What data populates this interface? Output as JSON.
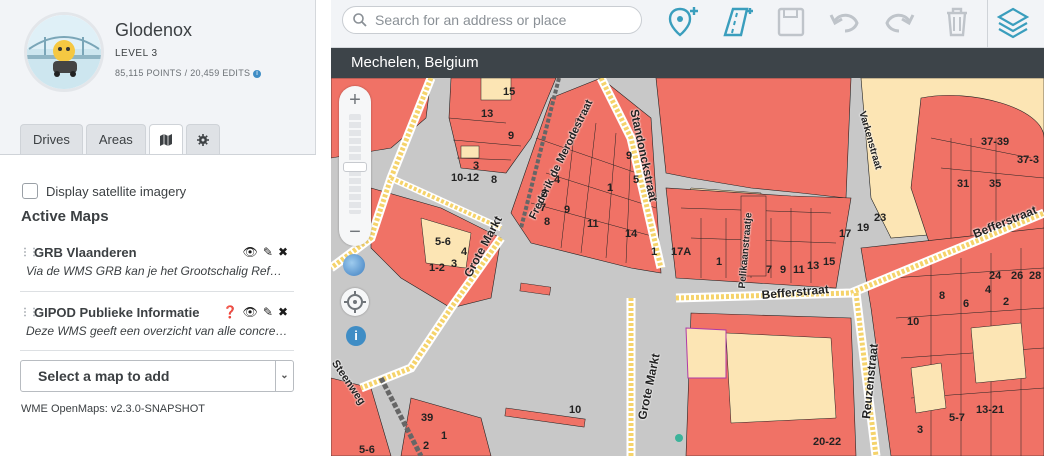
{
  "profile": {
    "username": "Glodenox",
    "level": "LEVEL 3",
    "points": "85,115 POINTS",
    "separator": "/",
    "edits": "20,459 EDITS"
  },
  "tabs": [
    {
      "label": "Drives"
    },
    {
      "label": "Areas"
    },
    {
      "label": "map-icon"
    },
    {
      "label": "gear-icon"
    }
  ],
  "panel": {
    "satellite_label": "Display satellite imagery",
    "active_maps_title": "Active Maps",
    "maps": [
      {
        "title": "GRB Vlaanderen",
        "desc": "Via de WMS GRB kan je het Grootschalig Referentie Bestand raadplegen"
      },
      {
        "title": "GIPOD Publieke Informatie",
        "desc": "Deze WMS geeft een overzicht van alle concrete werken en manifestaties"
      }
    ],
    "select_label": "Select a map to add",
    "version": "WME OpenMaps: v2.3.0-SNAPSHOT"
  },
  "search": {
    "placeholder": "Search for an address or place"
  },
  "city": "Mechelen, Belgium",
  "map_labels": {
    "streets": [
      "Grote Markt",
      "Grote Markt",
      "Frederik de Merodestraat",
      "Standonckstraat",
      "Befferstraat",
      "Befferstraat",
      "Reuzenstraat",
      "Varkenstraat",
      "Pelikaanstraatje",
      "Steenweg"
    ],
    "numbers": [
      "15",
      "13",
      "9",
      "3",
      "10-12",
      "8",
      "4",
      "2",
      "7",
      "8",
      "9",
      "11",
      "1",
      "5",
      "9",
      "14",
      "1",
      "17A",
      "1",
      "7",
      "9",
      "11",
      "13",
      "15",
      "17",
      "19",
      "23",
      "31",
      "35",
      "37-39",
      "37-3",
      "5-6",
      "4",
      "1-2",
      "3",
      "10",
      "8",
      "6",
      "4",
      "2",
      "24",
      "26",
      "28",
      "13-21",
      "5-7",
      "3",
      "20-22",
      "39",
      "2",
      "1",
      "5-6",
      "10"
    ]
  },
  "colors": {
    "accent": "#3f8dc5",
    "building": "#f07266",
    "building_light": "#fce5b4",
    "road": "#c8c8c8"
  }
}
